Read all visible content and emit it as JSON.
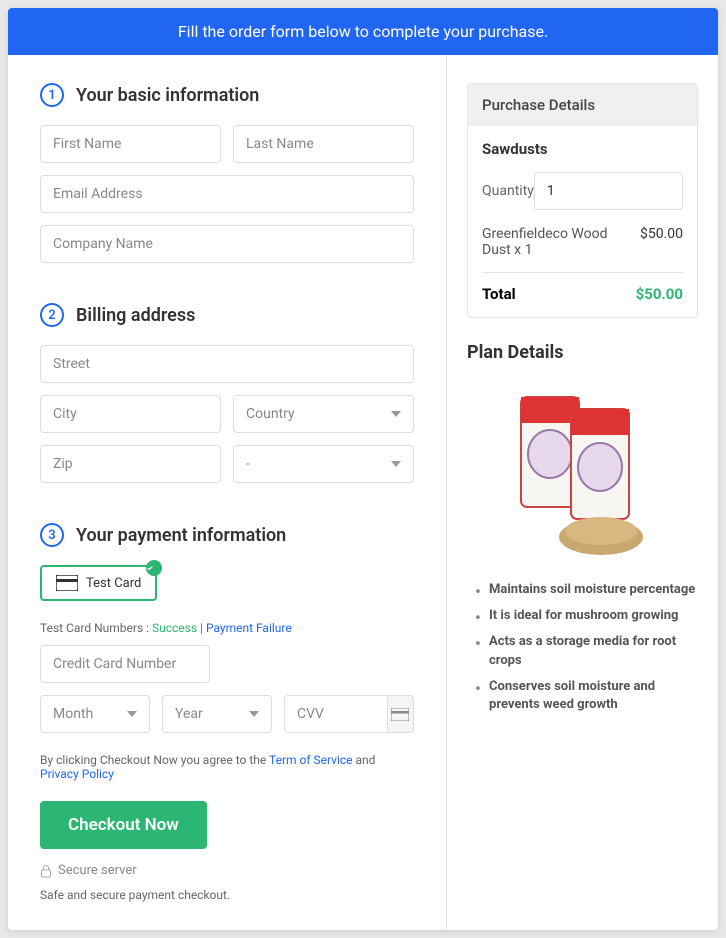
{
  "banner": "Fill the order form below to complete your purchase.",
  "steps": {
    "s1": {
      "num": "1",
      "title": "Your basic information"
    },
    "s2": {
      "num": "2",
      "title": "Billing address"
    },
    "s3": {
      "num": "3",
      "title": "Your payment information"
    }
  },
  "fields": {
    "first_name": "First Name",
    "last_name": "Last Name",
    "email": "Email Address",
    "company": "Company Name",
    "street": "Street",
    "city": "City",
    "country": "Country",
    "zip": "Zip",
    "state": "-",
    "cc_number": "Credit Card Number",
    "month": "Month",
    "year": "Year",
    "cvv": "CVV"
  },
  "card_option": "Test  Card",
  "test_line": {
    "prefix": "Test Card Numbers : ",
    "success": "Success",
    "sep": " | ",
    "failure": "Payment Failure"
  },
  "terms": {
    "prefix": "By clicking Checkout Now you agree to the ",
    "tos": "Term of Service",
    "and": " and ",
    "privacy": "Privacy Policy"
  },
  "checkout_btn": "Checkout Now",
  "secure": "Secure server",
  "safe": "Safe and secure payment checkout.",
  "purchase": {
    "header": "Purchase Details",
    "product": "Sawdusts",
    "qty_label": "Quantity",
    "qty_value": "1",
    "line_desc": "Greenfieldeco Wood Dust x 1",
    "line_price": "$50.00",
    "total_label": "Total",
    "total_amount": "$50.00"
  },
  "plan": {
    "title": "Plan Details",
    "features": [
      "Maintains soil moisture percentage",
      "It is ideal for mushroom growing",
      "Acts as a storage media for root crops",
      "Conserves soil moisture and prevents weed growth"
    ]
  }
}
